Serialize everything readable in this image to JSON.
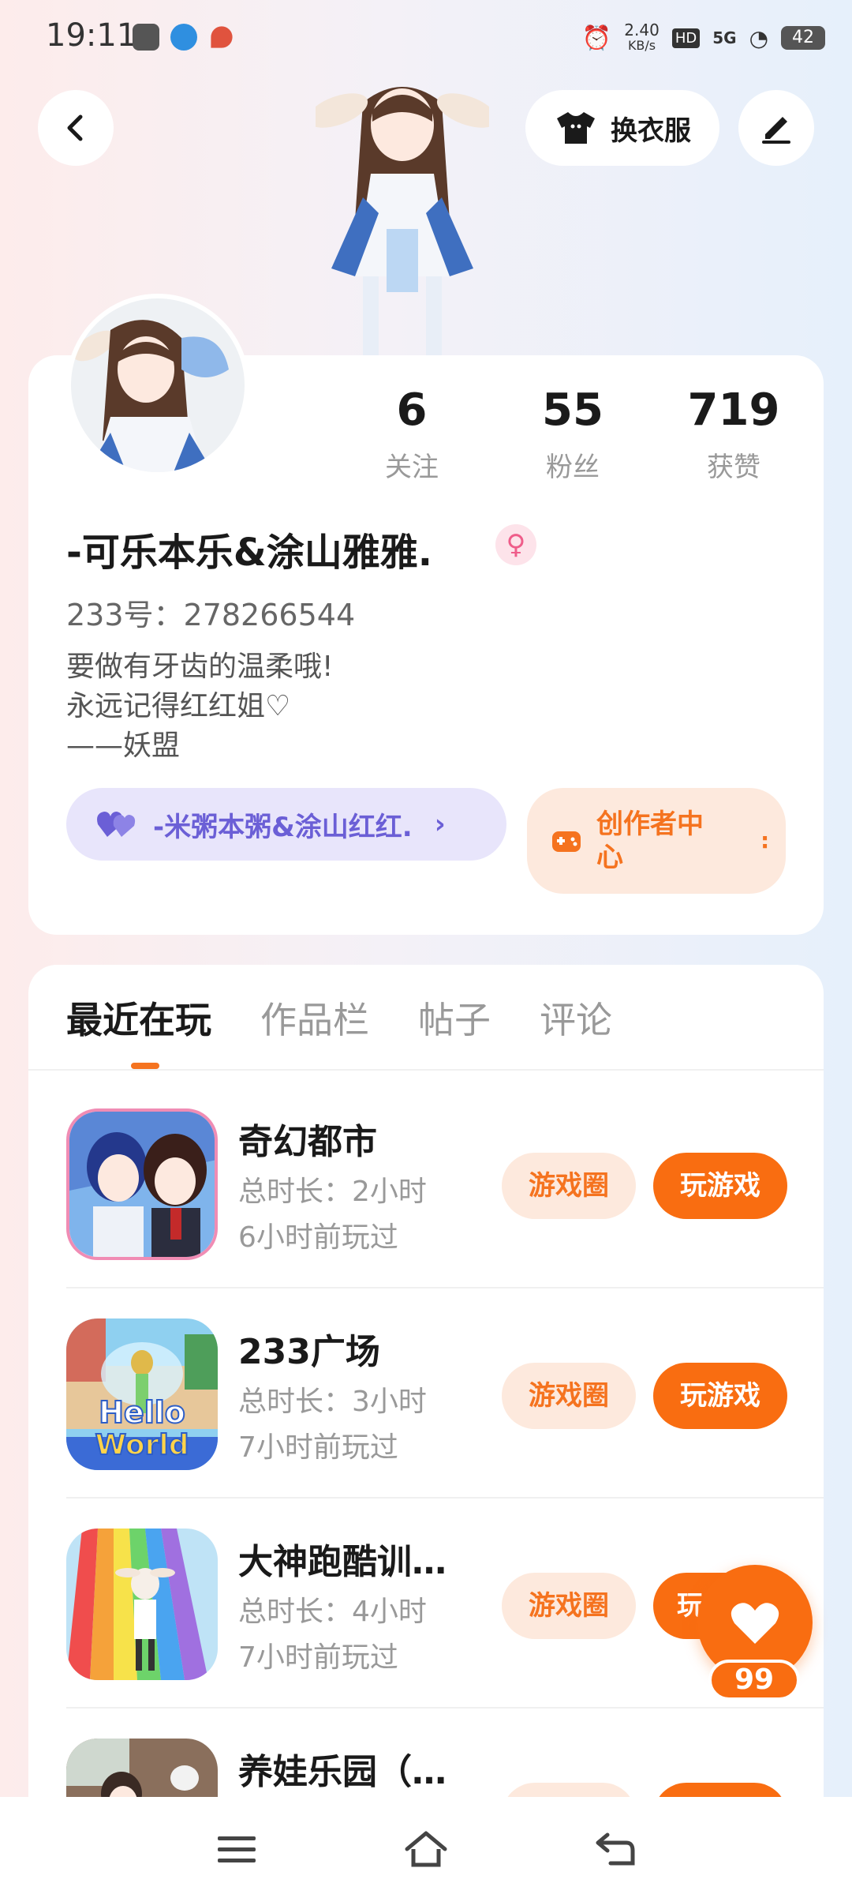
{
  "status_bar": {
    "time": "19:11",
    "net_speed_value": "2.40",
    "net_speed_unit": "KB/s",
    "hd": "HD",
    "signal": "5G",
    "battery": "42"
  },
  "header": {
    "dress_up_label": "换衣服"
  },
  "profile": {
    "stats": [
      {
        "value": "6",
        "label": "关注"
      },
      {
        "value": "55",
        "label": "粉丝"
      },
      {
        "value": "719",
        "label": "获赞"
      }
    ],
    "nickname": "-可乐本乐&涂山雅雅.",
    "gender_symbol": "♀",
    "id_text": "233号：278266544",
    "bio_lines": [
      "要做有牙齿的温柔哦!",
      "永远记得红红姐♡",
      "——妖盟"
    ],
    "partner_label": "-米粥本粥&涂山红红.",
    "creator_label_line1": "创作者中",
    "creator_label_line2": "心",
    "creator_marker": ":"
  },
  "tabs": [
    {
      "label": "最近在玩",
      "active": true
    },
    {
      "label": "作品栏",
      "active": false
    },
    {
      "label": "帖子",
      "active": false
    },
    {
      "label": "评论",
      "active": false
    }
  ],
  "games": [
    {
      "name": "奇幻都市",
      "duration": "总时长：2小时",
      "last_played": "6小时前玩过",
      "circle_label": "游戏圈",
      "play_label": "玩游戏"
    },
    {
      "name": "233广场",
      "duration": "总时长：3小时",
      "last_played": "7小时前玩过",
      "circle_label": "游戏圈",
      "play_label": "玩游戏",
      "thumb_text_1": "Hello",
      "thumb_text_2": "World"
    },
    {
      "name": "大神跑酷训…",
      "duration": "总时长：4小时",
      "last_played": "7小时前玩过",
      "circle_label": "游戏圈",
      "play_label": "玩"
    },
    {
      "name": "养娃乐园（…",
      "duration": "",
      "last_played": "",
      "circle_label": "",
      "play_label": ""
    }
  ],
  "floating_like": {
    "count": "99"
  },
  "colors": {
    "accent_orange": "#f96d11",
    "light_orange": "#fde9dd",
    "partner_purple": "#6b5fd6",
    "partner_bg": "#e8e5fb"
  }
}
